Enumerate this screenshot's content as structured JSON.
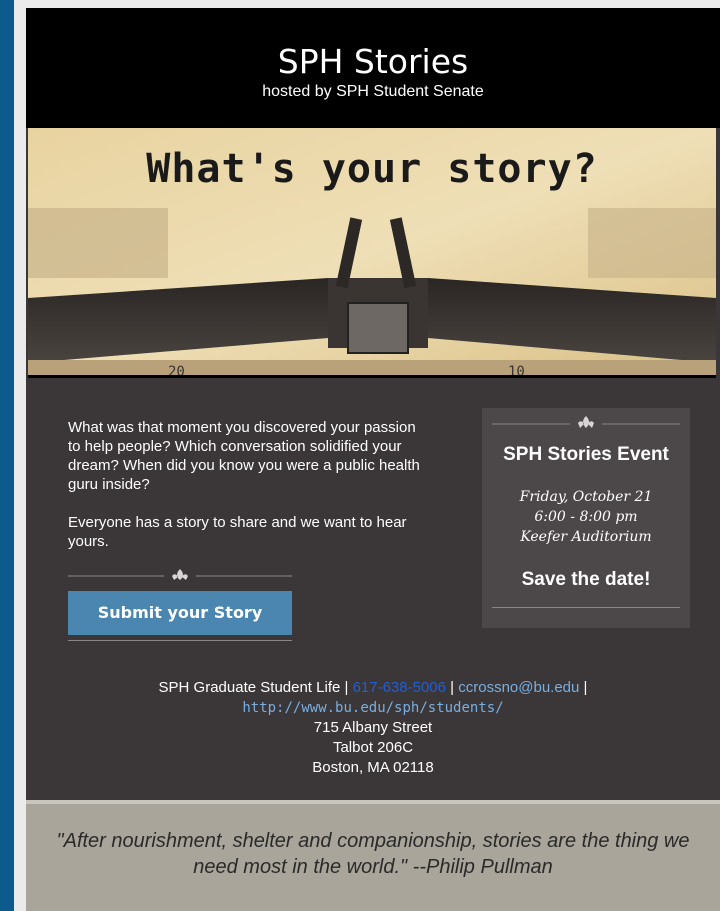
{
  "header": {
    "title": "SPH Stories",
    "subtitle": "hosted by SPH Student Senate"
  },
  "hero": {
    "headline": "What's your story?"
  },
  "intro": {
    "paragraph1": "What was that moment you discovered your passion to help people? Which conversation solidified your dream? When did you know you were a public health guru inside?",
    "paragraph2": "Everyone has a story to share and we want to hear yours."
  },
  "submit": {
    "label": "Submit your Story"
  },
  "event": {
    "title": "SPH Stories Event",
    "date": "Friday, October 21",
    "time": "6:00 - 8:00 pm",
    "location": "Keefer Auditorium",
    "cta": "Save the date!"
  },
  "contact": {
    "org": "SPH Graduate Student Life |",
    "phone": "617-638-5006",
    "sep": "|",
    "email": "ccrossno@bu.edu",
    "trail": "|",
    "url": "http://www.bu.edu/sph/students/",
    "street": "715 Albany Street",
    "room": "Talbot 206C",
    "city": "Boston, MA 02118"
  },
  "quote": {
    "text": "\"After nourishment, shelter and companionship, stories are the thing we need most in the world.\"  --Philip Pullman"
  },
  "colors": {
    "accent": "#4a86b0",
    "background": "#3b3637",
    "frame": "#0d5a8c"
  },
  "icons": {
    "ornament": "fleur-de-lis-icon"
  }
}
